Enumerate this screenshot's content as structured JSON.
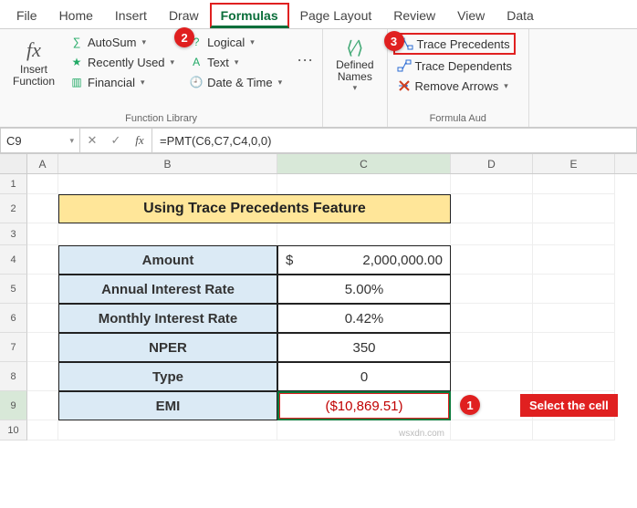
{
  "tabs": [
    "File",
    "Home",
    "Insert",
    "Draw",
    "Formulas",
    "Page Layout",
    "Review",
    "View",
    "Data"
  ],
  "active_tab": "Formulas",
  "ribbon": {
    "insert_function": "Insert\nFunction",
    "lib": {
      "group_label": "Function Library",
      "autosum": "AutoSum",
      "recent": "Recently Used",
      "financial": "Financial",
      "logical": "Logical",
      "text": "Text",
      "datetime": "Date & Time"
    },
    "defined_names": {
      "label": "Defined\nNames"
    },
    "audit": {
      "group_label": "Formula Aud",
      "trace_precedents": "Trace Precedents",
      "trace_dependents": "Trace Dependents",
      "remove_arrows": "Remove Arrows"
    }
  },
  "steps": {
    "s1": "1",
    "s2": "2",
    "s3": "3"
  },
  "formula_bar": {
    "name_box": "C9",
    "formula": "=PMT(C6,C7,C4,0,0)"
  },
  "columns": [
    "A",
    "B",
    "C",
    "D",
    "E"
  ],
  "row_numbers": [
    "1",
    "2",
    "3",
    "4",
    "5",
    "6",
    "7",
    "8",
    "9",
    "10"
  ],
  "sheet": {
    "title": "Using Trace Precedents Feature",
    "rows": {
      "r4": {
        "label": "Amount",
        "currency": "$",
        "value": "2,000,000.00"
      },
      "r5": {
        "label": "Annual Interest Rate",
        "value": "5.00%"
      },
      "r6": {
        "label": "Monthly Interest Rate",
        "value": "0.42%"
      },
      "r7": {
        "label": "NPER",
        "value": "350"
      },
      "r8": {
        "label": "Type",
        "value": "0"
      },
      "r9": {
        "label": "EMI",
        "value": "($10,869.51)"
      }
    }
  },
  "callout": "Select the cell",
  "watermark": "wsxdn.com"
}
